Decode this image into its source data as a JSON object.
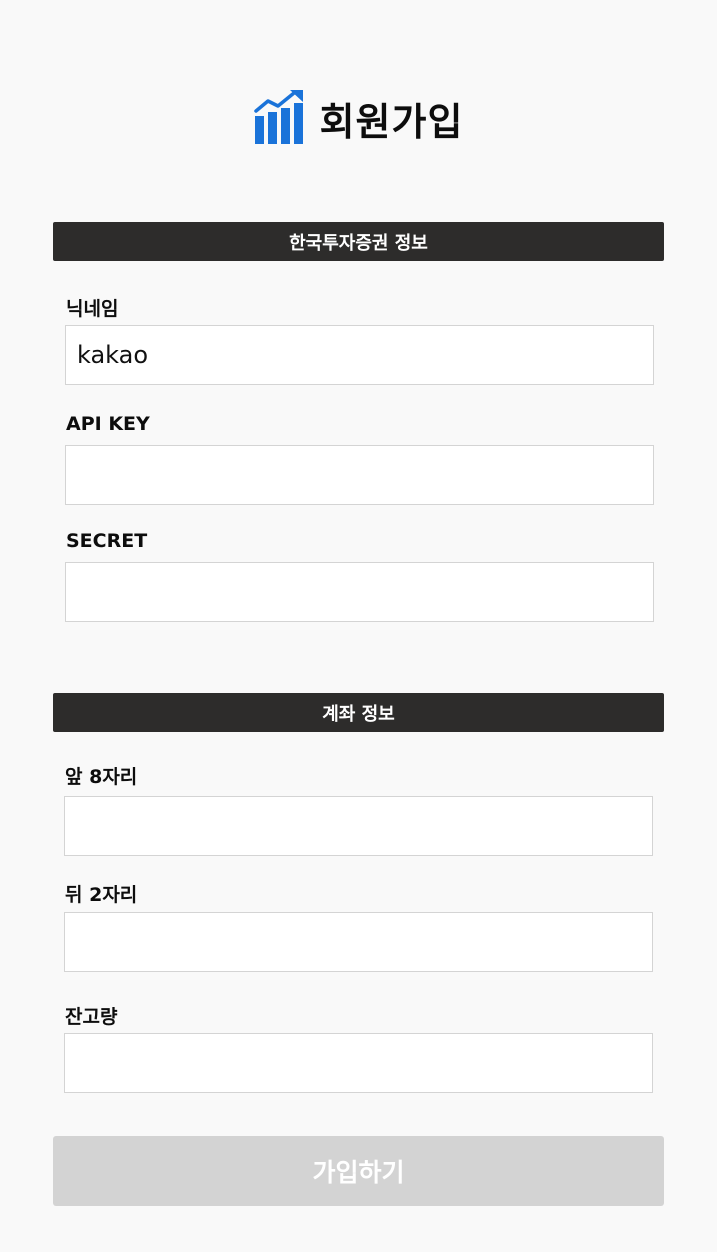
{
  "header": {
    "title": "회원가입",
    "logo_icon": "bar-chart-trend-icon",
    "logo_color": "#1a73d9"
  },
  "sections": {
    "broker_info": {
      "title": "한국투자증권 정보",
      "fields": {
        "nickname": {
          "label": "닉네임",
          "value": "kakao"
        },
        "api_key": {
          "label": "API KEY",
          "value": ""
        },
        "secret": {
          "label": "SECRET",
          "value": ""
        }
      }
    },
    "account_info": {
      "title": "계좌 정보",
      "fields": {
        "front8": {
          "label": "앞 8자리",
          "value": ""
        },
        "back2": {
          "label": "뒤 2자리",
          "value": ""
        },
        "balance": {
          "label": "잔고량",
          "value": ""
        }
      }
    }
  },
  "submit": {
    "label": "가입하기"
  },
  "colors": {
    "section_bar": "#2d2c2b",
    "submit_disabled": "#d3d3d3",
    "background": "#f9f9f9"
  }
}
